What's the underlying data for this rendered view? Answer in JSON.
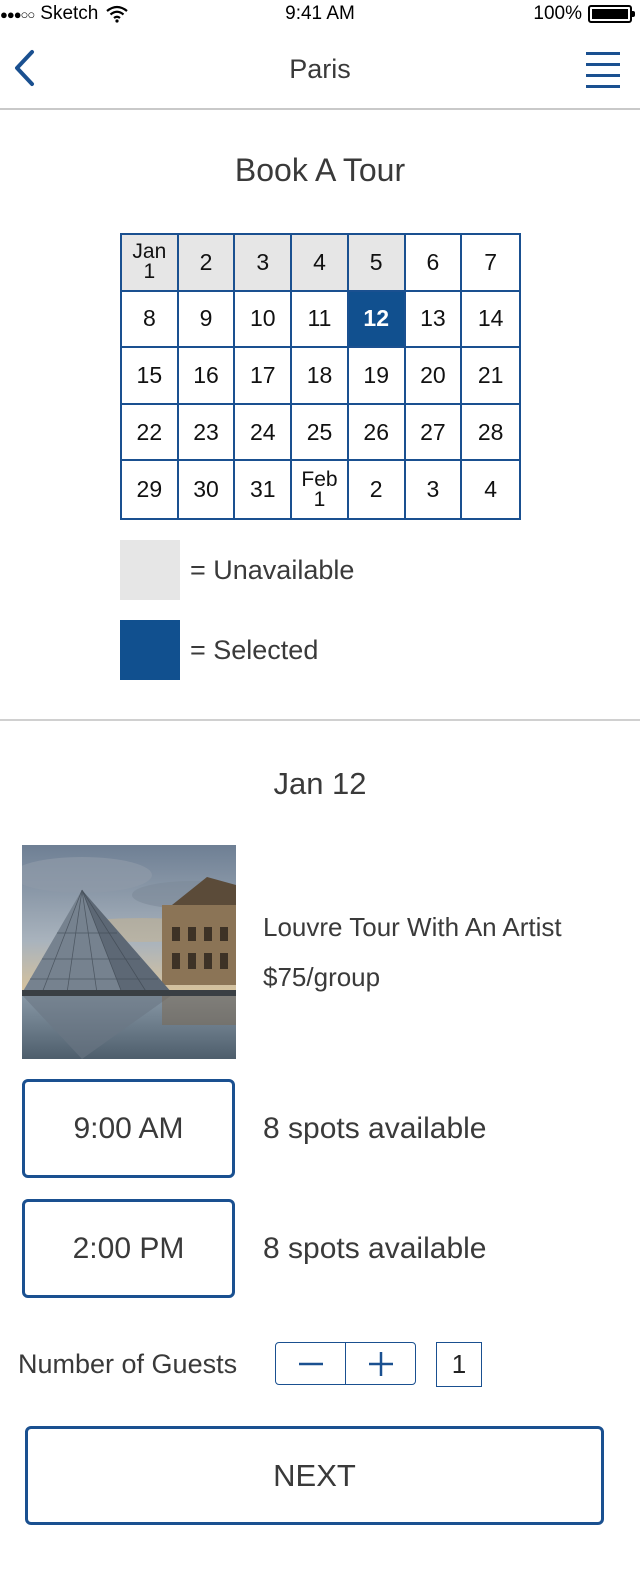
{
  "status_bar": {
    "signal": "●●●○○",
    "carrier": "Sketch",
    "time": "9:41 AM",
    "battery": "100%",
    "icons": [
      "wifi-icon",
      "battery-icon"
    ]
  },
  "nav": {
    "title": "Paris",
    "back_icon": "chevron-left-icon",
    "menu_icon": "hamburger-menu-icon"
  },
  "booking": {
    "title": "Book A Tour",
    "calendar": [
      {
        "label": "Jan\n1",
        "state": "unavailable"
      },
      {
        "label": "2",
        "state": "unavailable"
      },
      {
        "label": "3",
        "state": "unavailable"
      },
      {
        "label": "4",
        "state": "unavailable"
      },
      {
        "label": "5",
        "state": "unavailable"
      },
      {
        "label": "6",
        "state": "available"
      },
      {
        "label": "7",
        "state": "available"
      },
      {
        "label": "8",
        "state": "available"
      },
      {
        "label": "9",
        "state": "available"
      },
      {
        "label": "10",
        "state": "available"
      },
      {
        "label": "11",
        "state": "available"
      },
      {
        "label": "12",
        "state": "selected"
      },
      {
        "label": "13",
        "state": "available"
      },
      {
        "label": "14",
        "state": "available"
      },
      {
        "label": "15",
        "state": "available"
      },
      {
        "label": "16",
        "state": "available"
      },
      {
        "label": "17",
        "state": "available"
      },
      {
        "label": "18",
        "state": "available"
      },
      {
        "label": "19",
        "state": "available"
      },
      {
        "label": "20",
        "state": "available"
      },
      {
        "label": "21",
        "state": "available"
      },
      {
        "label": "22",
        "state": "available"
      },
      {
        "label": "23",
        "state": "available"
      },
      {
        "label": "24",
        "state": "available"
      },
      {
        "label": "25",
        "state": "available"
      },
      {
        "label": "26",
        "state": "available"
      },
      {
        "label": "27",
        "state": "available"
      },
      {
        "label": "28",
        "state": "available"
      },
      {
        "label": "29",
        "state": "available"
      },
      {
        "label": "30",
        "state": "available"
      },
      {
        "label": "31",
        "state": "available"
      },
      {
        "label": "Feb\n1",
        "state": "available"
      },
      {
        "label": "2",
        "state": "available"
      },
      {
        "label": "3",
        "state": "available"
      },
      {
        "label": "4",
        "state": "available"
      }
    ],
    "legend": {
      "unavailable": "= Unavailable",
      "selected": "= Selected"
    }
  },
  "tour": {
    "date": "Jan 12",
    "name": "Louvre Tour With An Artist",
    "price": "$75/group",
    "image": "louvre-pyramid-photo",
    "slots": [
      {
        "time": "9:00 AM",
        "spots": "8 spots available"
      },
      {
        "time": "2:00 PM",
        "spots": "8 spots available"
      }
    ]
  },
  "guests": {
    "label": "Number of Guests",
    "count": "1",
    "minus_icon": "minus-icon",
    "plus_icon": "plus-icon"
  },
  "next_label": "NEXT",
  "colors": {
    "accent": "#1a5090",
    "selected": "#11508f",
    "unavailable": "#e6e6e6",
    "text": "#3a3a3a"
  }
}
